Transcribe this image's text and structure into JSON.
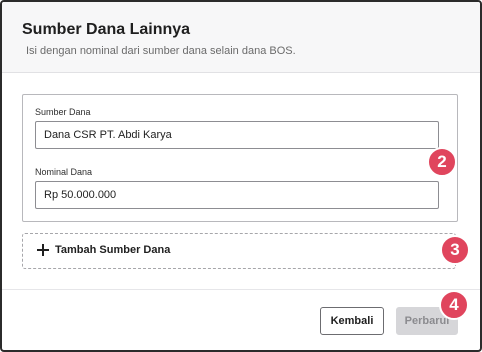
{
  "dialog": {
    "title": "Sumber Dana Lainnya",
    "subtitle": "Isi dengan nominal dari sumber dana selain dana BOS."
  },
  "form": {
    "source_label": "Sumber Dana",
    "source_value": "Dana CSR PT. Abdi Karya",
    "amount_label": "Nominal Dana",
    "amount_value": "Rp 50.000.000"
  },
  "add_source": {
    "label": "Tambah Sumber Dana",
    "icon": "plus-icon"
  },
  "footer": {
    "back_label": "Kembali",
    "update_label": "Perbarui"
  },
  "step_markers": [
    "2",
    "3",
    "4"
  ],
  "colors": {
    "marker": "#e0455d",
    "disabled_button": "#d6d6d9",
    "header_bg": "#f7f7f8"
  }
}
